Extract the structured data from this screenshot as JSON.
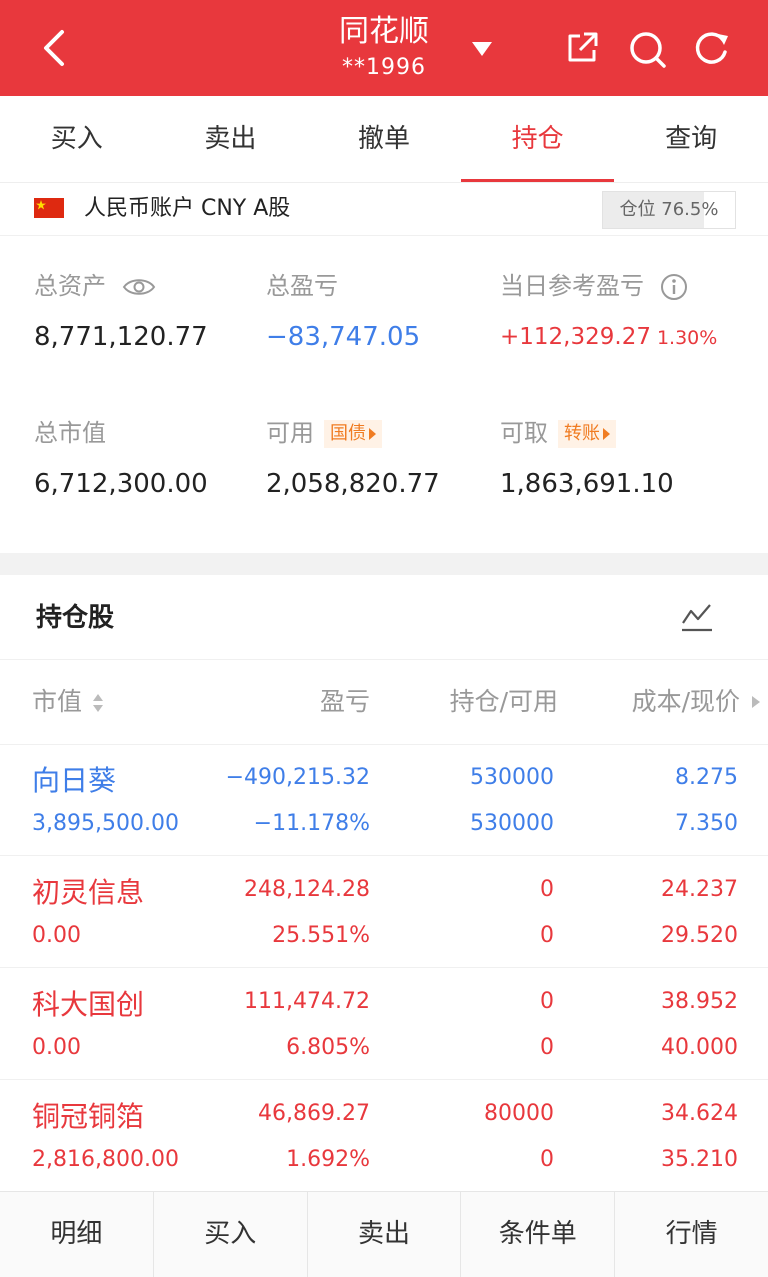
{
  "header": {
    "title": "同花顺",
    "account": "**1996"
  },
  "tabs": [
    {
      "label": "买入"
    },
    {
      "label": "卖出"
    },
    {
      "label": "撤单"
    },
    {
      "label": "持仓",
      "active": true
    },
    {
      "label": "查询"
    }
  ],
  "account_bar": {
    "label": "人民币账户 CNY A股",
    "position_label": "仓位 76.5%",
    "position_fraction": 0.765
  },
  "summary": {
    "total_assets_label": "总资产",
    "total_assets": "8,771,120.77",
    "total_pl_label": "总盈亏",
    "total_pl": "−83,747.05",
    "daily_pl_label": "当日参考盈亏",
    "daily_pl": "+112,329.27",
    "daily_pl_pct": "1.30%",
    "market_value_label": "总市值",
    "market_value": "6,712,300.00",
    "available_label": "可用",
    "available_tag": "国债",
    "available": "2,058,820.77",
    "withdrawable_label": "可取",
    "withdrawable_tag": "转账",
    "withdrawable": "1,863,691.10"
  },
  "holdings": {
    "title": "持仓股",
    "columns": {
      "market_value": "市值",
      "pl": "盈亏",
      "position": "持仓/可用",
      "cost_price": "成本/现价"
    },
    "rows": [
      {
        "name": "向日葵",
        "market_value": "3,895,500.00",
        "pl": "−490,215.32",
        "pl_pct": "−11.178%",
        "position": "530000",
        "available": "530000",
        "cost": "8.275",
        "price": "7.350",
        "color": "#3f7ee8"
      },
      {
        "name": "初灵信息",
        "market_value": "0.00",
        "pl": "248,124.28",
        "pl_pct": "25.551%",
        "position": "0",
        "available": "0",
        "cost": "24.237",
        "price": "29.520",
        "color": "#e8383d"
      },
      {
        "name": "科大国创",
        "market_value": "0.00",
        "pl": "111,474.72",
        "pl_pct": "6.805%",
        "position": "0",
        "available": "0",
        "cost": "38.952",
        "price": "40.000",
        "color": "#e8383d"
      },
      {
        "name": "铜冠铜箔",
        "market_value": "2,816,800.00",
        "pl": "46,869.27",
        "pl_pct": "1.692%",
        "position": "80000",
        "available": "0",
        "cost": "34.624",
        "price": "35.210",
        "color": "#e8383d"
      }
    ]
  },
  "bottom_bar": [
    {
      "label": "明细"
    },
    {
      "label": "买入"
    },
    {
      "label": "卖出"
    },
    {
      "label": "条件单"
    },
    {
      "label": "行情"
    }
  ],
  "colors": {
    "brand": "#e8383d",
    "loss": "#3f7ee8",
    "gain": "#e8383d",
    "tag": "#f07c22"
  },
  "icons": [
    "back-icon",
    "dropdown-icon",
    "share-icon",
    "search-icon",
    "refresh-icon",
    "cn-flag-icon",
    "eye-icon",
    "info-icon",
    "trend-chart-icon",
    "sort-icon",
    "scroll-right-icon"
  ]
}
